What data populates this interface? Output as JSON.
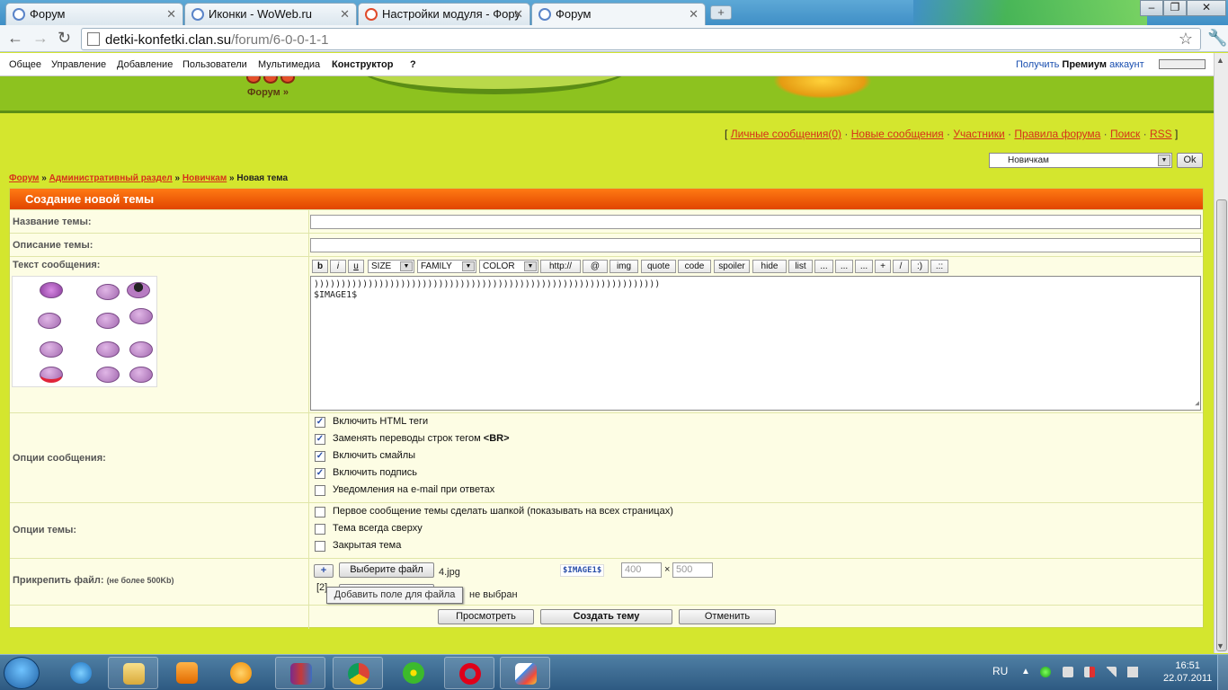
{
  "browser": {
    "tabs": [
      {
        "label": "Форум",
        "icon": "site-favicon-icon"
      },
      {
        "label": "Иконки - WoWeb.ru",
        "icon": "site-favicon-icon"
      },
      {
        "label": "Настройки модуля - Фору",
        "icon": "opera-favicon-icon"
      },
      {
        "label": "Форум",
        "icon": "site-favicon-icon"
      }
    ],
    "url_host": "detki-konfetki.clan.su",
    "url_path": "/forum/6-0-0-1-1"
  },
  "ucoz_menu": {
    "items": [
      "Общее",
      "Управление",
      "Добавление",
      "Пользователи",
      "Мультимедиа",
      "Конструктор",
      "?"
    ],
    "premium_prefix": "Получить ",
    "premium_bold": "Премиум",
    "premium_suffix": " аккаунт"
  },
  "banner": {
    "forum_link": "Форум »"
  },
  "top_links": {
    "open": "[",
    "items": [
      "Личные сообщения(0)",
      "Новые сообщения",
      "Участники",
      "Правила форума",
      "Поиск",
      "RSS"
    ],
    "sep": "·",
    "close": "]"
  },
  "forum_jump": {
    "selected": "Новичкам",
    "ok": "Ok"
  },
  "breadcrumbs": {
    "items": [
      "Форум",
      "Административный раздел",
      "Новичкам"
    ],
    "sep": "»",
    "current": "Новая тема"
  },
  "form": {
    "title": "Создание новой темы",
    "topic_name_label": "Название темы:",
    "topic_desc_label": "Описание темы:",
    "message_label": "Текст сообщения:",
    "message_text": "))))))))))))))))))))))))))))))))))))))))))))))))))))))))))))))))\n$IMAGE1$",
    "bbcode": {
      "b": "b",
      "i": "i",
      "u": "u",
      "size": "SIZE",
      "family": "FAMILY",
      "color": "COLOR",
      "http": "http://",
      "at": "@",
      "img": "img",
      "quote": "quote",
      "code": "code",
      "spoiler": "spoiler",
      "hide": "hide",
      "list": "list",
      "dots1": "...",
      "dots2": "...",
      "dots3": "...",
      "plus": "+",
      "slash": "/",
      "smile": ":)",
      "more": ".::"
    },
    "message_options_label": "Опции сообщения:",
    "message_options": [
      {
        "label": "Включить HTML теги",
        "checked": true
      },
      {
        "label": "Заменять переводы строк тегом ",
        "bold": "<BR>",
        "checked": true
      },
      {
        "label": "Включить смайлы",
        "checked": true
      },
      {
        "label": "Включить подпись",
        "checked": true
      },
      {
        "label": "Уведомления на e-mail при ответах",
        "checked": false
      }
    ],
    "topic_options_label": "Опции темы:",
    "topic_options": [
      {
        "label": "Первое сообщение темы сделать шапкой (показывать на всех страницах)",
        "checked": false
      },
      {
        "label": "Тема всегда сверху",
        "checked": false
      },
      {
        "label": "Закрытая тема",
        "checked": false
      }
    ],
    "check_mark": "✓",
    "attach_label": "Прикрепить файл:",
    "attach_note": "(не более 500Kb)",
    "attach": {
      "add_button": "+",
      "choose_file": "Выберите файл",
      "file1_name": "4.jpg",
      "image_code": "$IMAGE1$",
      "width_placeholder": "400",
      "times": "×",
      "height_placeholder": "500",
      "file2_index": "[2]",
      "file2_status": "не выбран",
      "tooltip": "Добавить поле для файла"
    },
    "preview_button": "Просмотреть",
    "create_button": "Создать тему",
    "cancel_button": "Отменить"
  },
  "taskbar": {
    "apps": [
      "internet-explorer-icon",
      "file-explorer-icon",
      "media-player-icon",
      "mail-agent-icon",
      "winrar-icon",
      "chrome-icon",
      "icq-icon",
      "opera-icon",
      "paint-icon"
    ],
    "lang": "RU",
    "time": "16:51",
    "date": "22.07.2011"
  },
  "colors": {
    "form_header": "#ff5a00",
    "page_bg": "#d4e62e",
    "link": "#d6311a"
  }
}
